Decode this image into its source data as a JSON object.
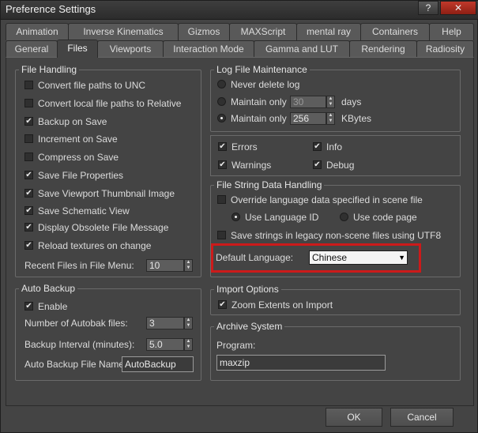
{
  "window": {
    "title": "Preference Settings",
    "help_label": "?",
    "close_label": "✕"
  },
  "tabs_row1": [
    "Animation",
    "Inverse Kinematics",
    "Gizmos",
    "MAXScript",
    "mental ray",
    "Containers",
    "Help"
  ],
  "tabs_row2": [
    "General",
    "Files",
    "Viewports",
    "Interaction Mode",
    "Gamma and LUT",
    "Rendering",
    "Radiosity"
  ],
  "active_tab": "Files",
  "file_handling": {
    "title": "File Handling",
    "items": [
      {
        "label": "Convert file paths to UNC",
        "checked": false
      },
      {
        "label": "Convert local file paths to Relative",
        "checked": false
      },
      {
        "label": "Backup on Save",
        "checked": true
      },
      {
        "label": "Increment on Save",
        "checked": false
      },
      {
        "label": "Compress on Save",
        "checked": false
      },
      {
        "label": "Save File Properties",
        "checked": true
      },
      {
        "label": "Save Viewport Thumbnail Image",
        "checked": true
      },
      {
        "label": "Save Schematic View",
        "checked": true
      },
      {
        "label": "Display Obsolete File Message",
        "checked": true
      },
      {
        "label": "Reload textures on change",
        "checked": true
      }
    ],
    "recent_label": "Recent Files in File Menu:",
    "recent_value": "10"
  },
  "auto_backup": {
    "title": "Auto Backup",
    "enable_label": "Enable",
    "enable_checked": true,
    "count_label": "Number of Autobak files:",
    "count_value": "3",
    "interval_label": "Backup Interval (minutes):",
    "interval_value": "5.0",
    "name_label": "Auto Backup File Name:",
    "name_value": "AutoBackup"
  },
  "log_file": {
    "title": "Log File Maintenance",
    "never_delete": "Never delete log",
    "maintain_days_label": "Maintain only",
    "maintain_days_value": "30",
    "days_unit": "days",
    "maintain_kb_label": "Maintain only",
    "maintain_kb_value": "256",
    "kb_unit": "KBytes",
    "selected": "kbytes",
    "errors": "Errors",
    "info": "Info",
    "warnings": "Warnings",
    "debug": "Debug"
  },
  "file_string": {
    "title": "File String Data Handling",
    "override_label": "Override language data specified in scene file",
    "use_language_id": "Use Language ID",
    "use_code_page": "Use code page",
    "legacy_label": "Save strings in legacy non-scene files using UTF8",
    "default_language_label": "Default Language:",
    "default_language_value": "Chinese"
  },
  "import_options": {
    "title": "Import Options",
    "zoom_label": "Zoom Extents on Import"
  },
  "archive": {
    "title": "Archive System",
    "program_label": "Program:",
    "program_value": "maxzip"
  },
  "buttons": {
    "ok": "OK",
    "cancel": "Cancel"
  },
  "colors": {
    "highlight": "#cc1a1a",
    "background": "#444444"
  }
}
